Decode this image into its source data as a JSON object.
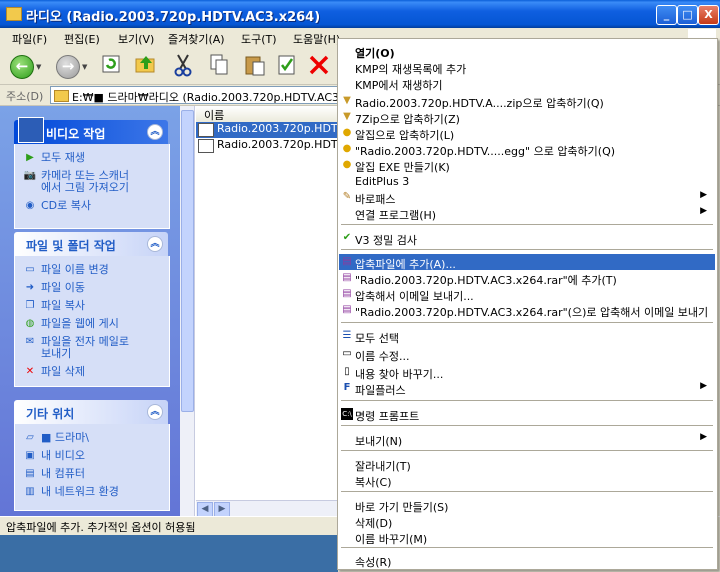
{
  "window": {
    "title": "라디오 (Radio.2003.720p.HDTV.AC3.x264)",
    "buttons": {
      "minimize": "_",
      "maximize": "□",
      "close": "X"
    }
  },
  "menubar": [
    "파일(F)",
    "편집(E)",
    "보기(V)",
    "즐겨찾기(A)",
    "도구(T)",
    "도움말(H)"
  ],
  "toolbar": {
    "back_icon": "back-arrow-icon",
    "forward_icon": "forward-arrow-icon",
    "tools": [
      "refresh-icon",
      "up-folder-icon",
      "cut-icon",
      "copy-icon",
      "paste-icon",
      "properties-icon",
      "delete-icon"
    ]
  },
  "address": {
    "label": "주소(D)",
    "path": "E:₩■ 드라마₩라디오 (Radio.2003.720p.HDTV.AC3"
  },
  "taskpane": {
    "video_tasks": {
      "title": "비디오 작업",
      "items": [
        "모두 재생",
        "카메라 또는 스캐너",
        "에서 그림 가져오기",
        "CD로 복사"
      ]
    },
    "file_tasks": {
      "title": "파일 및 폴더 작업",
      "items": [
        "파일 이름 변경",
        "파일 이동",
        "파일 복사",
        "파일을 웹에 게시",
        "파일을 전자 메일로",
        "보내기",
        "파일 삭제"
      ]
    },
    "other_places": {
      "title": "기타 위치",
      "items": [
        "■ 드라마\\",
        "내 비디오",
        "내 컴퓨터",
        "내 네트워크 환경"
      ]
    }
  },
  "filelist": {
    "column_name": "이름",
    "rows": [
      {
        "name": "Radio.2003.720p.HDTV.AC3.x264",
        "selected": true
      },
      {
        "name": "Radio.2003.720p.HDTV.AC3.x264",
        "selected": false
      }
    ]
  },
  "status": "압축파일에 추가. 추가적인 옵션이 허용됨",
  "context_menu": {
    "items": [
      {
        "label": "열기(O)",
        "bold": true
      },
      {
        "label": "KMP의 재생목록에 추가"
      },
      {
        "label": "KMP에서 재생하기"
      },
      {
        "label": "Radio.2003.720p.HDTV.A....zip으로 압축하기(Q)",
        "icon": "zip-icon"
      },
      {
        "label": "7Zip으로 압축하기(Z)",
        "icon": "zip-icon"
      },
      {
        "label": "알집으로 압축하기(L)",
        "icon": "alzip-icon"
      },
      {
        "label": "\"Radio.2003.720p.HDTV.....egg\" 으로 압축하기(Q)",
        "icon": "alzip-icon"
      },
      {
        "label": "알집 EXE 만들기(K)",
        "icon": "alzip-icon"
      },
      {
        "label": "EditPlus 3"
      },
      {
        "label": "바로패스",
        "icon": "barofass-icon",
        "submenu": true
      },
      {
        "label": "연결 프로그램(H)",
        "submenu": true
      },
      {
        "label": "V3 정밀 검사",
        "icon": "v3-icon"
      },
      {
        "label": "압축파일에 추가(A)...",
        "icon": "winrar-icon",
        "highlighted": true
      },
      {
        "label": "\"Radio.2003.720p.HDTV.AC3.x264.rar\"에 추가(T)",
        "icon": "winrar-icon"
      },
      {
        "label": "압축해서 이메일 보내기...",
        "icon": "winrar-icon"
      },
      {
        "label": "\"Radio.2003.720p.HDTV.AC3.x264.rar\"(으)로 압축해서 이메일 보내기",
        "icon": "winrar-icon"
      },
      {
        "label": "모두 선택",
        "icon": "select-all-icon"
      },
      {
        "label": "이름 수정...",
        "icon": "rename-icon"
      },
      {
        "label": "내용 찾아 바꾸기...",
        "icon": "find-replace-icon"
      },
      {
        "label": "파일플러스",
        "icon": "fileplus-icon",
        "submenu": true
      },
      {
        "label": "명령 프롬프트",
        "icon": "cmd-icon"
      },
      {
        "label": "보내기(N)",
        "submenu": true
      },
      {
        "label": "잘라내기(T)"
      },
      {
        "label": "복사(C)"
      },
      {
        "label": "바로 가기 만들기(S)"
      },
      {
        "label": "삭제(D)"
      },
      {
        "label": "이름 바꾸기(M)"
      },
      {
        "label": "속성(R)"
      }
    ]
  }
}
